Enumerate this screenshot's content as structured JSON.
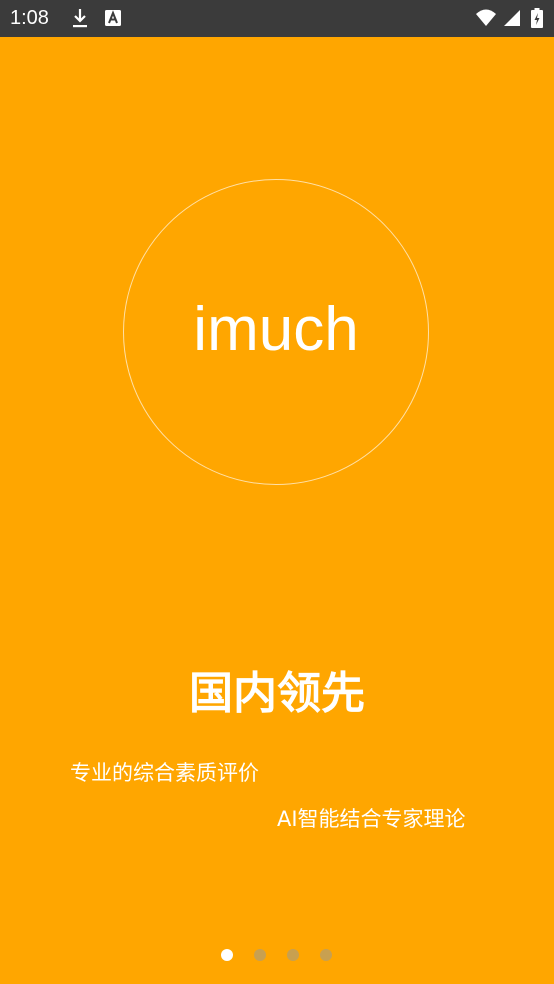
{
  "status_bar": {
    "time": "1:08",
    "icons": [
      "download-icon",
      "text-a-icon",
      "wifi-icon",
      "signal-icon",
      "battery-icon"
    ]
  },
  "logo": {
    "text": "imuch"
  },
  "onboarding": {
    "headline": "国内领先",
    "line1": "专业的综合素质评价",
    "line2": "AI智能结合专家理论"
  },
  "pager": {
    "total": 4,
    "active_index": 0
  },
  "colors": {
    "background": "#FFA600",
    "status_bar": "#3B3B3B",
    "text": "#FFFFFF",
    "dot_active": "#FFFFFF",
    "dot_inactive": "#C8A050"
  }
}
